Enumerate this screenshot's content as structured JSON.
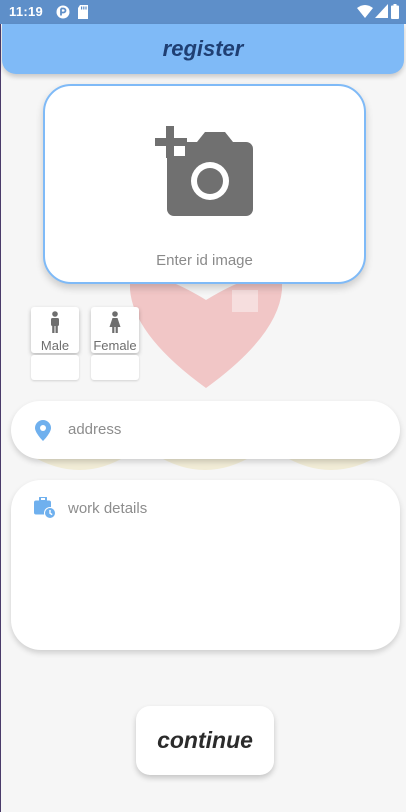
{
  "status_bar": {
    "time": "11:19",
    "icons": [
      "app-notification-icon",
      "sd-card-icon",
      "wifi-icon",
      "signal-icon",
      "battery-icon"
    ]
  },
  "app_bar": {
    "title": "register"
  },
  "id_card": {
    "label": "Enter id image",
    "icon": "add-a-photo-icon"
  },
  "gender": {
    "options": [
      {
        "label": "Male",
        "icon": "male-icon"
      },
      {
        "label": "Female",
        "icon": "female-icon"
      }
    ]
  },
  "address": {
    "placeholder": "address",
    "icon": "location-pin-icon"
  },
  "work": {
    "placeholder": "work details",
    "icon": "work-history-icon"
  },
  "continue_button": {
    "label": "continue"
  },
  "colors": {
    "status_bar": "#5e8fc9",
    "app_bar": "#7fbaf7",
    "title_text": "#1f3f73",
    "accent": "#7fbaf7",
    "background": "#f6f6f6"
  }
}
